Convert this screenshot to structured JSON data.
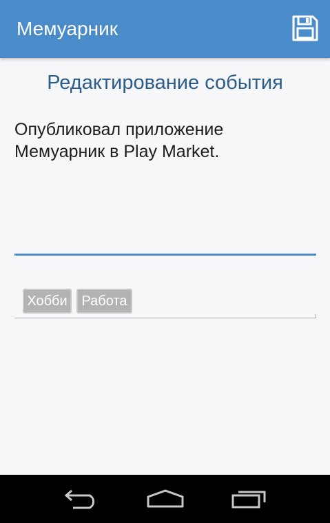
{
  "app_bar": {
    "title": "Мемуарник",
    "save_icon": "floppy-disk-icon",
    "background": "#4a8cc9"
  },
  "page": {
    "title": "Редактирование события"
  },
  "editor": {
    "value": "Опубликовал приложение\nМемуарник в Play Market.",
    "underline_color": "#4a8cc9"
  },
  "tags": {
    "items": [
      {
        "label": "Хобби"
      },
      {
        "label": "Работа"
      }
    ]
  },
  "nav_bar": {
    "back_icon": "back-arrow-icon",
    "home_icon": "home-icon",
    "recents_icon": "recent-apps-icon"
  }
}
